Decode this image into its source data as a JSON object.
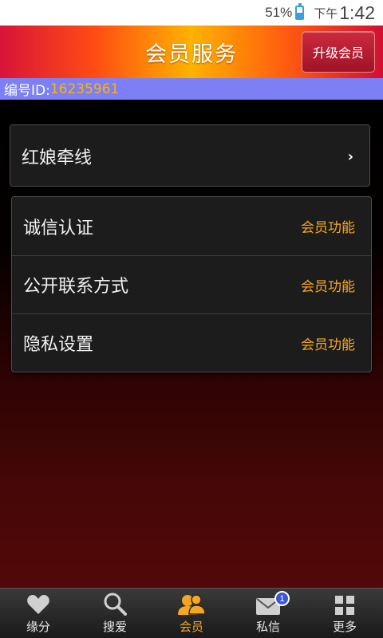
{
  "statusbar": {
    "battery": "51%",
    "ampm": "下午",
    "time": "1:42"
  },
  "header": {
    "title": "会员服务",
    "upgrade_label": "升级会员"
  },
  "idbar": {
    "label": "编号ID:",
    "value": "16235961"
  },
  "card1": {
    "items": [
      {
        "label": "红娘牵线",
        "chevron": "›"
      }
    ]
  },
  "card2": {
    "items": [
      {
        "label": "诚信认证",
        "tag": "会员功能"
      },
      {
        "label": "公开联系方式",
        "tag": "会员功能"
      },
      {
        "label": "隐私设置",
        "tag": "会员功能"
      }
    ]
  },
  "tabs": [
    {
      "label": "缘分",
      "icon": "heart-icon"
    },
    {
      "label": "搜爱",
      "icon": "search-icon"
    },
    {
      "label": "会员",
      "icon": "members-icon",
      "active": true
    },
    {
      "label": "私信",
      "icon": "mail-icon",
      "badge": "1"
    },
    {
      "label": "更多",
      "icon": "grid-icon"
    }
  ],
  "colors": {
    "accent": "#f5a623",
    "idbar_bg": "#7d80f5",
    "tab_active": "#f5a623"
  }
}
